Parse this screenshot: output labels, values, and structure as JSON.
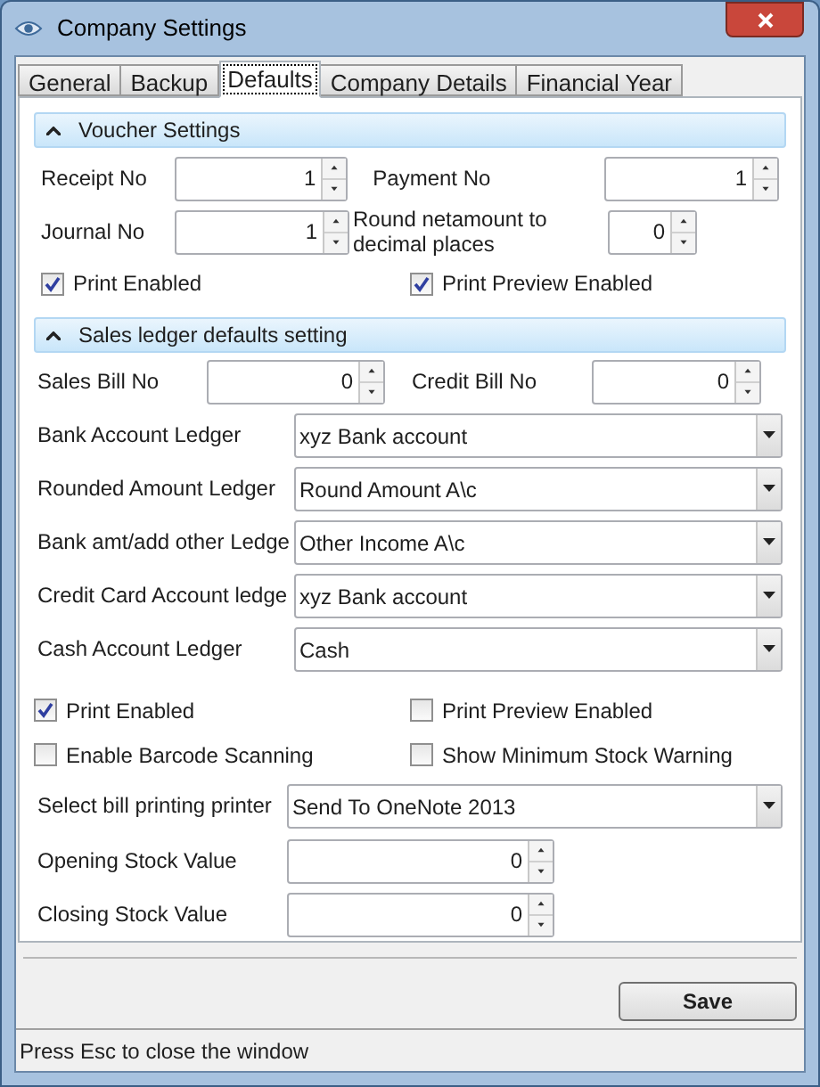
{
  "window": {
    "title": "Company Settings"
  },
  "tabs": [
    {
      "label": "General",
      "selected": false
    },
    {
      "label": "Backup",
      "selected": false
    },
    {
      "label": "Defaults",
      "selected": true
    },
    {
      "label": "Company Details",
      "selected": false
    },
    {
      "label": "Financial Year",
      "selected": false
    }
  ],
  "voucher_settings": {
    "title": "Voucher Settings",
    "expanded": true,
    "fields": [
      {
        "label": "Receipt No",
        "value": "1"
      },
      {
        "label": "Payment No",
        "value": "1"
      },
      {
        "label": "Journal No",
        "value": "1"
      },
      {
        "label": "Round netamount to decimal places",
        "value": "0"
      }
    ],
    "checkboxes": [
      {
        "label": "Print Enabled",
        "checked": true
      },
      {
        "label": "Print Preview Enabled",
        "checked": true
      }
    ]
  },
  "sales_ledger": {
    "title": "Sales ledger defaults setting",
    "expanded": true,
    "fields": [
      {
        "label": "Sales Bill No",
        "value": "0"
      },
      {
        "label": "Credit Bill No",
        "value": "0"
      }
    ],
    "ledgers": [
      {
        "label": "Bank Account Ledger",
        "value": "xyz Bank account"
      },
      {
        "label": "Rounded Amount Ledger",
        "value": "Round Amount A\\c"
      },
      {
        "label": "Bank amt/add other Ledge",
        "value": "Other Income A\\c"
      },
      {
        "label": "Credit Card Account ledge",
        "value": "xyz Bank account"
      },
      {
        "label": "Cash Account Ledger",
        "value": "Cash"
      }
    ],
    "checkboxes": [
      {
        "label": "Print Enabled",
        "checked": true
      },
      {
        "label": "Print Preview Enabled",
        "checked": false
      },
      {
        "label": "Enable Barcode Scanning",
        "checked": false
      },
      {
        "label": "Show Minimum Stock Warning",
        "checked": false
      }
    ],
    "printer": {
      "label": "Select bill printing printer",
      "value": "Send To OneNote 2013"
    },
    "stock_values": [
      {
        "label": "Opening Stock Value",
        "value": "0"
      },
      {
        "label": "Closing Stock Value",
        "value": "0"
      }
    ]
  },
  "save_button": "Save",
  "status_bar": "Press Esc to close the window"
}
